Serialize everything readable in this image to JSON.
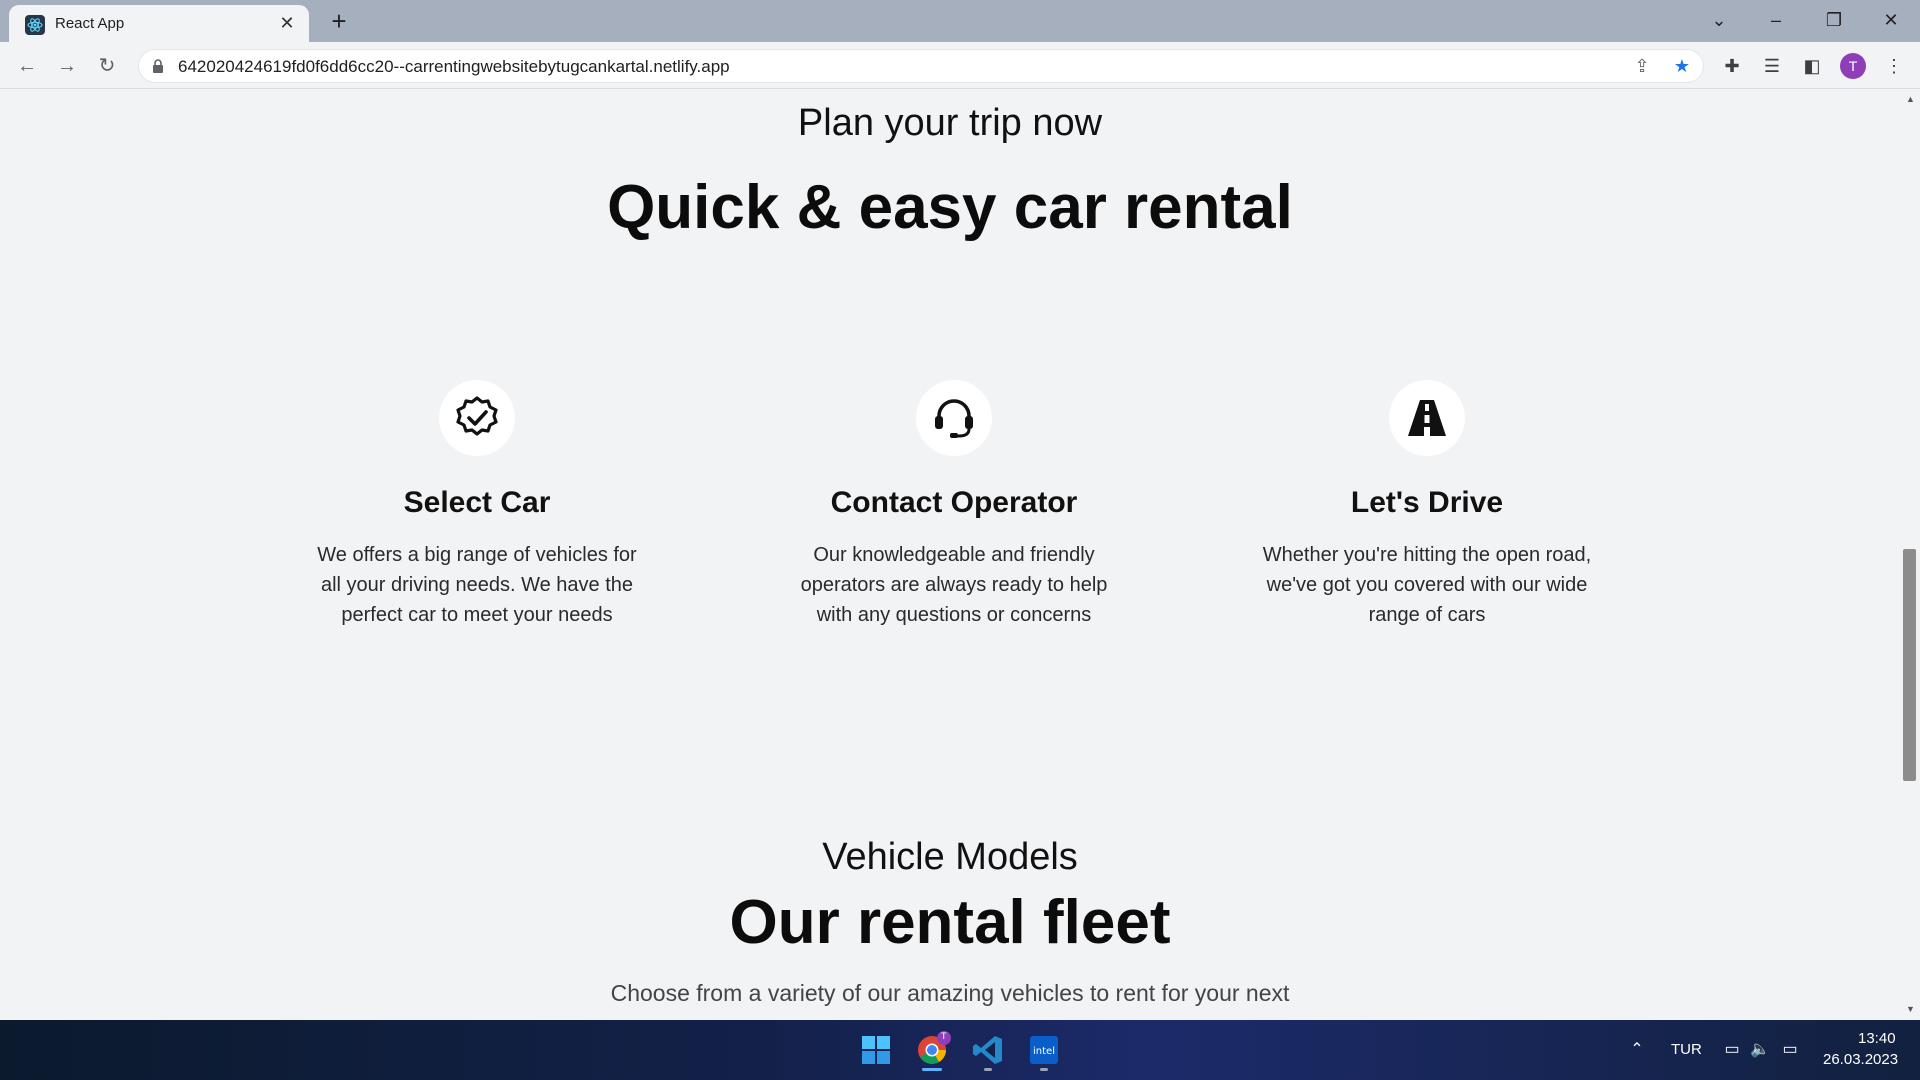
{
  "browser": {
    "tab_title": "React App",
    "url": "642020424619fd0f6dd6cc20--carrentingwebsitebytugcankartal.netlify.app",
    "profile_initial": "T"
  },
  "plan": {
    "subtitle": "Plan your trip now",
    "title": "Quick & easy car rental",
    "steps": [
      {
        "icon": "verified-badge-icon",
        "title": "Select Car",
        "text": "We offers a big range of vehicles for all your driving needs. We have the perfect car to meet your needs"
      },
      {
        "icon": "headset-icon",
        "title": "Contact Operator",
        "text": "Our knowledgeable and friendly operators are always ready to help with any questions or concerns"
      },
      {
        "icon": "road-icon",
        "title": "Let's Drive",
        "text": "Whether you're hitting the open road, we've got you covered with our wide range of cars"
      }
    ]
  },
  "models": {
    "subtitle": "Vehicle Models",
    "title": "Our rental fleet",
    "text": "Choose from a variety of our amazing vehicles to rent for your next"
  },
  "taskbar": {
    "language": "TUR",
    "time": "13:40",
    "date": "26.03.2023",
    "apps": [
      "windows-start-icon",
      "chrome-icon",
      "vscode-icon",
      "intel-icon"
    ],
    "chrome_badge": "T"
  }
}
